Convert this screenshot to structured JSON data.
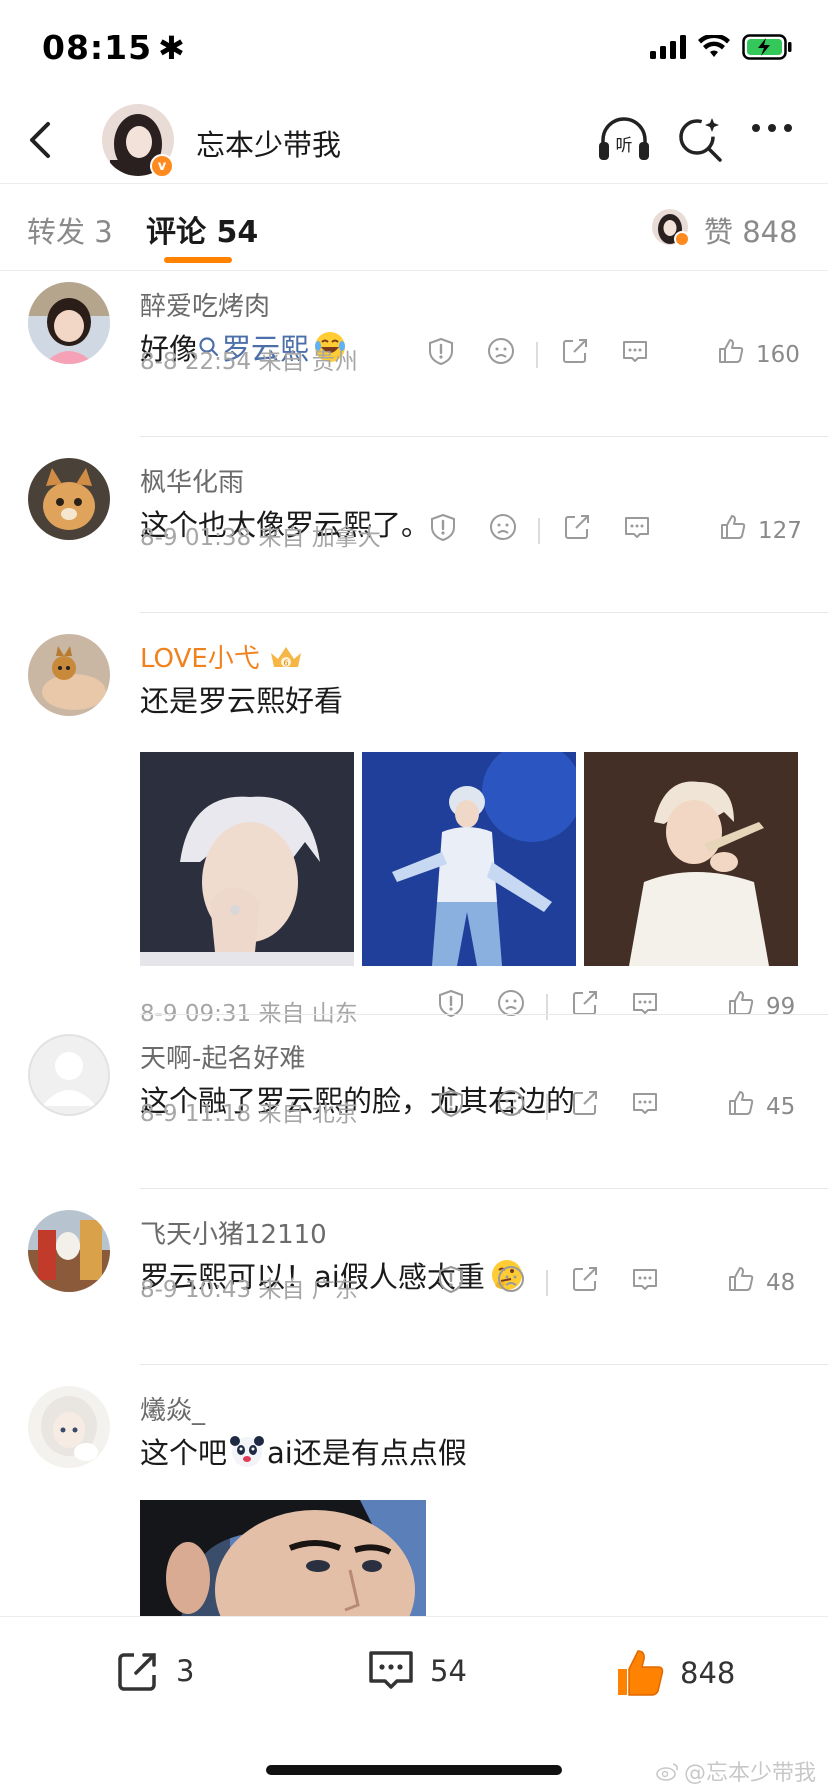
{
  "status_bar": {
    "time": "08:15",
    "time_extra_icon": "asterisk-icon"
  },
  "header": {
    "title": "忘本少带我",
    "verified_badge": "v"
  },
  "tabs": {
    "repost": "转发 3",
    "comment": "评论 54",
    "like": "赞 848"
  },
  "comments": [
    {
      "user": "醉爱吃烤肉",
      "text_prefix": "好像",
      "topic": "罗云熙",
      "emoji": "laughing-tears-emoji",
      "time": "8-8 22:54 来自 贵州",
      "likes": "160"
    },
    {
      "user": "枫华化雨",
      "text": "这个也太像罗云熙了。",
      "time": "8-9 01:38 来自 加拿大",
      "likes": "127"
    },
    {
      "user": "LOVE小弋",
      "user_badge": "crown-icon",
      "text": "还是罗云熙好看",
      "time": "8-9 09:31 来自 山东",
      "likes": "99"
    },
    {
      "user": "天啊-起名好难",
      "text": "这个融了罗云熙的脸，尤其右边的",
      "time": "8-9 11:18 来自 北京",
      "likes": "45"
    },
    {
      "user": "飞天小猪12110",
      "text": "罗云熙可以！ai假人感太重",
      "emoji": "thinking-face-emoji",
      "time": "8-9 10:43 来自 广东",
      "likes": "48"
    },
    {
      "user": "爔焱_",
      "text_prefix": "这个吧",
      "text_suffix": "ai还是有点点假",
      "emoji": "panda-emoji"
    }
  ],
  "bottom_bar": {
    "repost_count": "3",
    "comment_count": "54",
    "like_count": "848"
  },
  "watermark": "@忘本少带我",
  "colors": {
    "accent": "#ff8200",
    "topic_link": "#4d6fa9",
    "muted": "#a6a6a6",
    "vip_name": "#f0821e"
  }
}
